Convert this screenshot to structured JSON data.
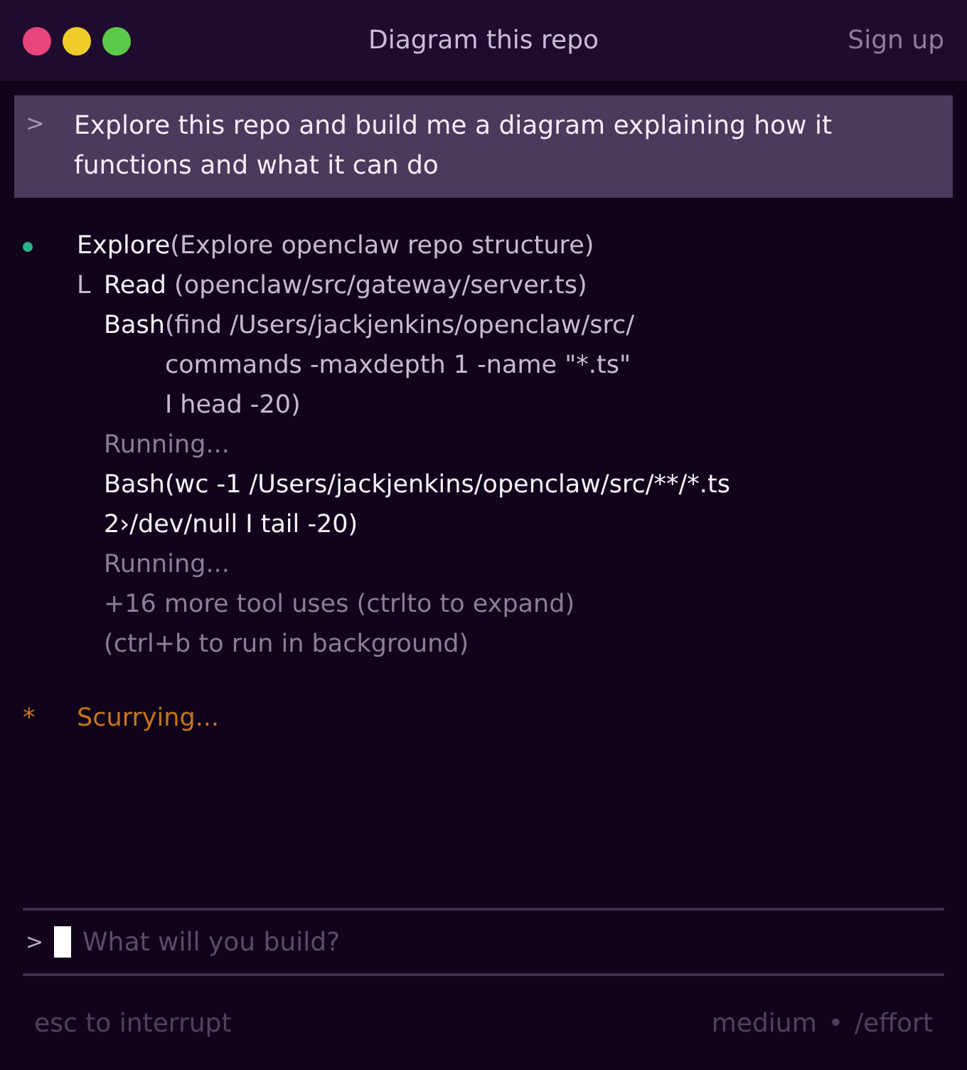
{
  "window": {
    "title": "Diagram this repo",
    "action": "Sign up"
  },
  "prompt": {
    "marker": ">",
    "text": "Explore this repo and build me a diagram explaining how it functions and what it can do"
  },
  "task": {
    "color": "#2bb58a",
    "name": "Explore",
    "args": "(Explore openclaw repo structure)",
    "children": [
      {
        "kind": "call",
        "prefix": "L",
        "name": "Read",
        "arg_lines": [
          " (openclaw/src/gateway/server.ts)"
        ]
      },
      {
        "kind": "call",
        "name": "Bash",
        "arg_lines": [
          "(find /Users/jackjenkins/openclaw/src/",
          "commands -maxdepth 1 -name \"*.ts\"",
          "I head -20)"
        ]
      },
      {
        "kind": "status",
        "text": "Running..."
      },
      {
        "kind": "command",
        "lines": [
          "Bash(wc -1 /Users/jackjenkins/openclaw/src/**/*.ts",
          "2›/dev/null I tail -20)"
        ]
      },
      {
        "kind": "status",
        "text": "Running..."
      },
      {
        "kind": "status",
        "text": "+16 more tool uses (ctrlto to expand)"
      },
      {
        "kind": "status",
        "text": "(ctrl+b to run in background)"
      }
    ]
  },
  "activity": {
    "marker": "*",
    "text": "Scurrying..."
  },
  "input": {
    "marker": ">",
    "placeholder": "What will you build?"
  },
  "footer": {
    "left": "esc to interrupt",
    "mode": "medium",
    "separator": "•",
    "command": "/effort"
  }
}
